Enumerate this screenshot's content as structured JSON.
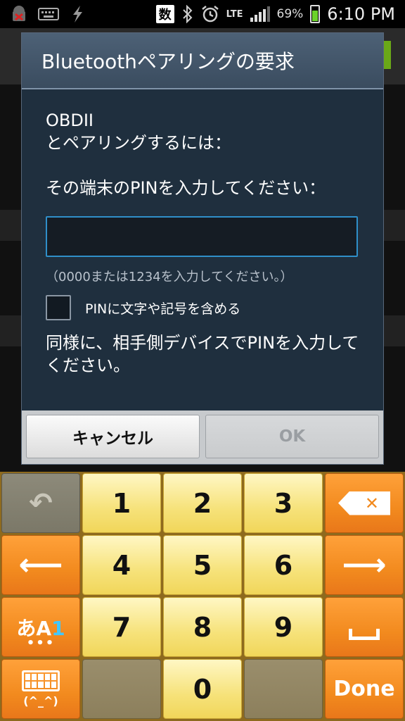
{
  "status_bar": {
    "ime_mode": "数",
    "network": "LTE",
    "battery_percent": "69%",
    "time": "6:10 PM",
    "icons": [
      "android-debug-icon",
      "keyboard-icon",
      "usb-icon",
      "bluetooth-icon",
      "alarm-icon",
      "signal-icon",
      "battery-icon"
    ]
  },
  "dialog": {
    "title": "Bluetoothペアリングの要求",
    "device_name": "OBDII",
    "pair_with_text": "とペアリングするには：",
    "prompt": "その端末のPINを入力してください：",
    "pin_value": "",
    "hint": "（0000または1234を入力してください。）",
    "checkbox_label": "PINに文字や記号を含める",
    "checkbox_checked": false,
    "note": "同様に、相手側デバイスでPINを入力してください。",
    "cancel_label": "キャンセル",
    "ok_label": "OK",
    "ok_enabled": false
  },
  "keyboard": {
    "digits": [
      "1",
      "2",
      "3",
      "4",
      "5",
      "6",
      "7",
      "8",
      "9",
      "0"
    ],
    "mode_label_a": "あA",
    "mode_label_1": "1",
    "mode_dots": "•••",
    "emoticon_label": "(^_^)",
    "done_label": "Done",
    "backspace_symbol": "✕",
    "left_arrow": "⟵",
    "right_arrow": "⟶",
    "undo_symbol": "↶",
    "colors": {
      "digit_key": "#f6e27a",
      "function_key": "#f28a1e",
      "inactive_key": "#7b7868"
    }
  }
}
